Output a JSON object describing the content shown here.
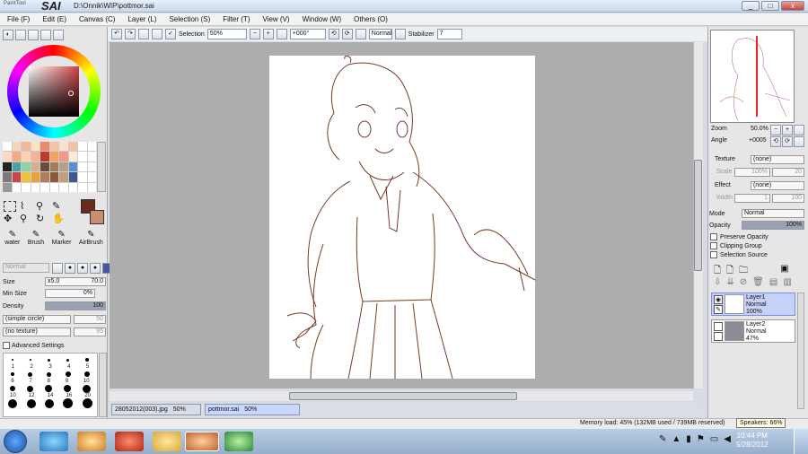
{
  "app": {
    "brand_small": "PaintTool",
    "brand": "SAI",
    "path": "D:\\Onnik\\WIP\\pottmor.sai"
  },
  "window_buttons": [
    "_",
    "□",
    "x"
  ],
  "menu": [
    "File (F)",
    "Edit (E)",
    "Canvas (C)",
    "Layer (L)",
    "Selection (S)",
    "Filter (T)",
    "View (V)",
    "Window (W)",
    "Others (O)"
  ],
  "toolbar": {
    "selection_label": "Selection",
    "zoom": "50%",
    "angle": "+000°",
    "blend": "Normal",
    "stabilizer_label": "Stabilizer",
    "stabilizer_value": "7"
  },
  "tools": {
    "labels": [
      "water",
      "Brush",
      "Marker",
      "AirBrush"
    ],
    "mode": "Normal"
  },
  "brush": {
    "size_label": "Size",
    "size_mult": "x5.0",
    "size_value": "70.0",
    "min_size_label": "Min Size",
    "min_size_value": "0%",
    "density_label": "Density",
    "density_value": "100",
    "shape": "(simple circle)",
    "shape_value": "50",
    "texture": "(no texture)",
    "texture_value": "95",
    "advanced": "Advanced Settings",
    "sizes_row1": [
      "1",
      "2",
      "3",
      "4",
      "5"
    ],
    "sizes_row2": [
      "6",
      "7",
      "8",
      "9",
      "10"
    ],
    "sizes_row3": [
      "10",
      "12",
      "14",
      "16",
      "20"
    ],
    "sizes_row4": [
      "25",
      "30",
      "35",
      "40",
      "50"
    ]
  },
  "navigator": {
    "zoom_label": "Zoom",
    "zoom_value": "50.0%",
    "angle_label": "Angle",
    "angle_value": "+0005"
  },
  "layer_props": {
    "texture_label": "Texture",
    "texture_value": "(none)",
    "scale_label": "Scale",
    "scale_value": "100%",
    "scale_num": "20",
    "effect_label": "Effect",
    "effect_value": "(none)",
    "width_label": "Width",
    "width_value": "1",
    "width_num": "100",
    "mode_label": "Mode",
    "mode_value": "Normal",
    "opacity_label": "Opacity",
    "opacity_value": "100%",
    "preserve_opacity": "Preserve Opacity",
    "clipping_group": "Clipping Group",
    "selection_source": "Selection Source"
  },
  "layers": [
    {
      "name": "Layer1",
      "mode": "Normal",
      "opacity": "100%"
    },
    {
      "name": "Layer2",
      "mode": "Normal",
      "opacity": "47%"
    }
  ],
  "documents": [
    {
      "name": "28052012(003).jpg",
      "zoom": "50%"
    },
    {
      "name": "pottmor.sai",
      "zoom": "50%"
    }
  ],
  "status": {
    "memory": "Memory load: 45% (132MB used / 739MB reserved)",
    "speakers": "Speakers: 66%"
  },
  "clock": {
    "time": "10:44 PM",
    "date": "5/28/2012"
  },
  "colors": {
    "current": "#6b2a1a",
    "secondary": "#c98e6e",
    "line": "#7a3a26"
  }
}
